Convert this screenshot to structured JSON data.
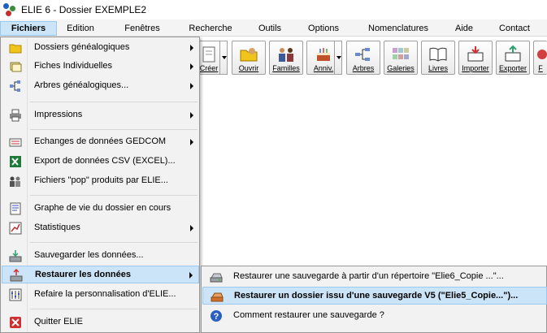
{
  "window": {
    "title": "ELIE 6 - Dossier  EXEMPLE2"
  },
  "menubar": {
    "items": [
      "Fichiers",
      "Edition",
      "Fenêtres",
      "Recherche",
      "Outils",
      "Options",
      "Nomenclatures",
      "Aide",
      "Contact"
    ]
  },
  "toolbar": {
    "buttons": [
      "Créer",
      "Ouvrir",
      "Familles",
      "Anniv.",
      "Arbres",
      "Galeries",
      "Livres",
      "Importer",
      "Exporter",
      "F"
    ]
  },
  "file_menu": {
    "items": [
      {
        "label": "Dossiers généalogiques",
        "icon": "folder-icon",
        "submenu": true
      },
      {
        "label": "Fiches Individuelles",
        "icon": "index-cards-icon",
        "submenu": true
      },
      {
        "label": "Arbres généalogiques...",
        "icon": "tree-icon",
        "submenu": true
      },
      {
        "label": "Impressions",
        "icon": "printer-icon",
        "submenu": true
      },
      {
        "label": "Echanges de données GEDCOM",
        "icon": "gedcom-icon",
        "submenu": true
      },
      {
        "label": "Export de données CSV (EXCEL)...",
        "icon": "excel-icon",
        "submenu": false
      },
      {
        "label": "Fichiers \"pop\" produits par ELIE...",
        "icon": "pop-files-icon",
        "submenu": false
      },
      {
        "label": "Graphe de vie du dossier en cours",
        "icon": "life-graph-icon",
        "submenu": false
      },
      {
        "label": "Statistiques",
        "icon": "statistics-icon",
        "submenu": true
      },
      {
        "label": "Sauvegarder les données...",
        "icon": "save-data-icon",
        "submenu": false
      },
      {
        "label": "Restaurer les données",
        "icon": "restore-data-icon",
        "submenu": true
      },
      {
        "label": "Refaire la personnalisation d'ELIE...",
        "icon": "customize-icon",
        "submenu": false
      },
      {
        "label": "Quitter ELIE",
        "icon": "quit-icon",
        "submenu": false
      }
    ]
  },
  "restore_submenu": {
    "items": [
      {
        "label": "Restaurer une sauvegarde à partir d'un répertoire \"Elie6_Copie ...\"...",
        "icon": "drive-icon"
      },
      {
        "label": "Restaurer un dossier issu d'une sauvegarde V5 (\"Elie5_Copie...\")...",
        "icon": "drive-orange-icon"
      },
      {
        "label": "Comment restaurer une sauvegarde ?",
        "icon": "help-icon"
      }
    ]
  },
  "colors": {
    "highlight": "#cce4f7",
    "highlight_border": "#99c9ef",
    "menu_bg": "#f2f2f2"
  }
}
